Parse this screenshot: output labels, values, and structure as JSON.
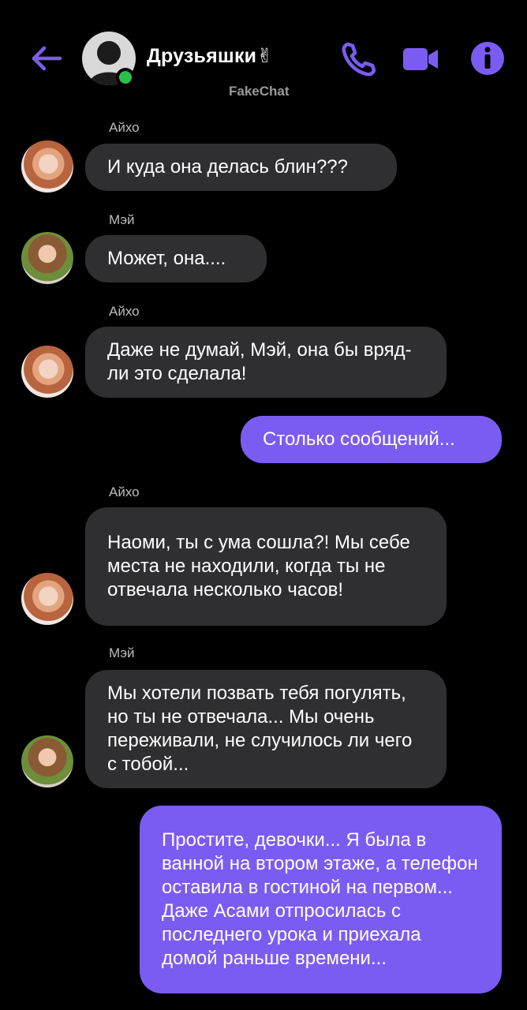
{
  "header": {
    "title": "Друзьяшки✌",
    "subtitle": "FakeChat"
  },
  "colors": {
    "accent": "#7b5cf2",
    "incoming_bubble": "#2f2f31",
    "online": "#27c14a",
    "background": "#000000"
  },
  "icons": [
    "back-arrow-icon",
    "phone-icon",
    "video-camera-icon",
    "info-icon"
  ],
  "messages": [
    {
      "sender": "Айхо",
      "text": "И куда она делась блин???"
    },
    {
      "sender": "Мэй",
      "text": "Может, она...."
    },
    {
      "sender": "Айхо",
      "text": "Даже не думай, Мэй, она бы вряд-ли это сделала!"
    },
    {
      "sender": "",
      "text": "Столько сообщений..."
    },
    {
      "sender": "Айхо",
      "text": "Наоми, ты с ума сошла?! Мы себе места не находили, когда ты не отвечала несколько часов!"
    },
    {
      "sender": "Мэй",
      "text": "Мы хотели позвать тебя погулять, но ты не отвечала... Мы очень переживали, не случилось ли чего с тобой..."
    },
    {
      "sender": "",
      "text": "Простите, девочки... Я была в ванной на втором этаже, а телефон оставила в гостиной на первом... Даже Асами отпросилась с последнего урока и приехала домой раньше времени..."
    }
  ]
}
